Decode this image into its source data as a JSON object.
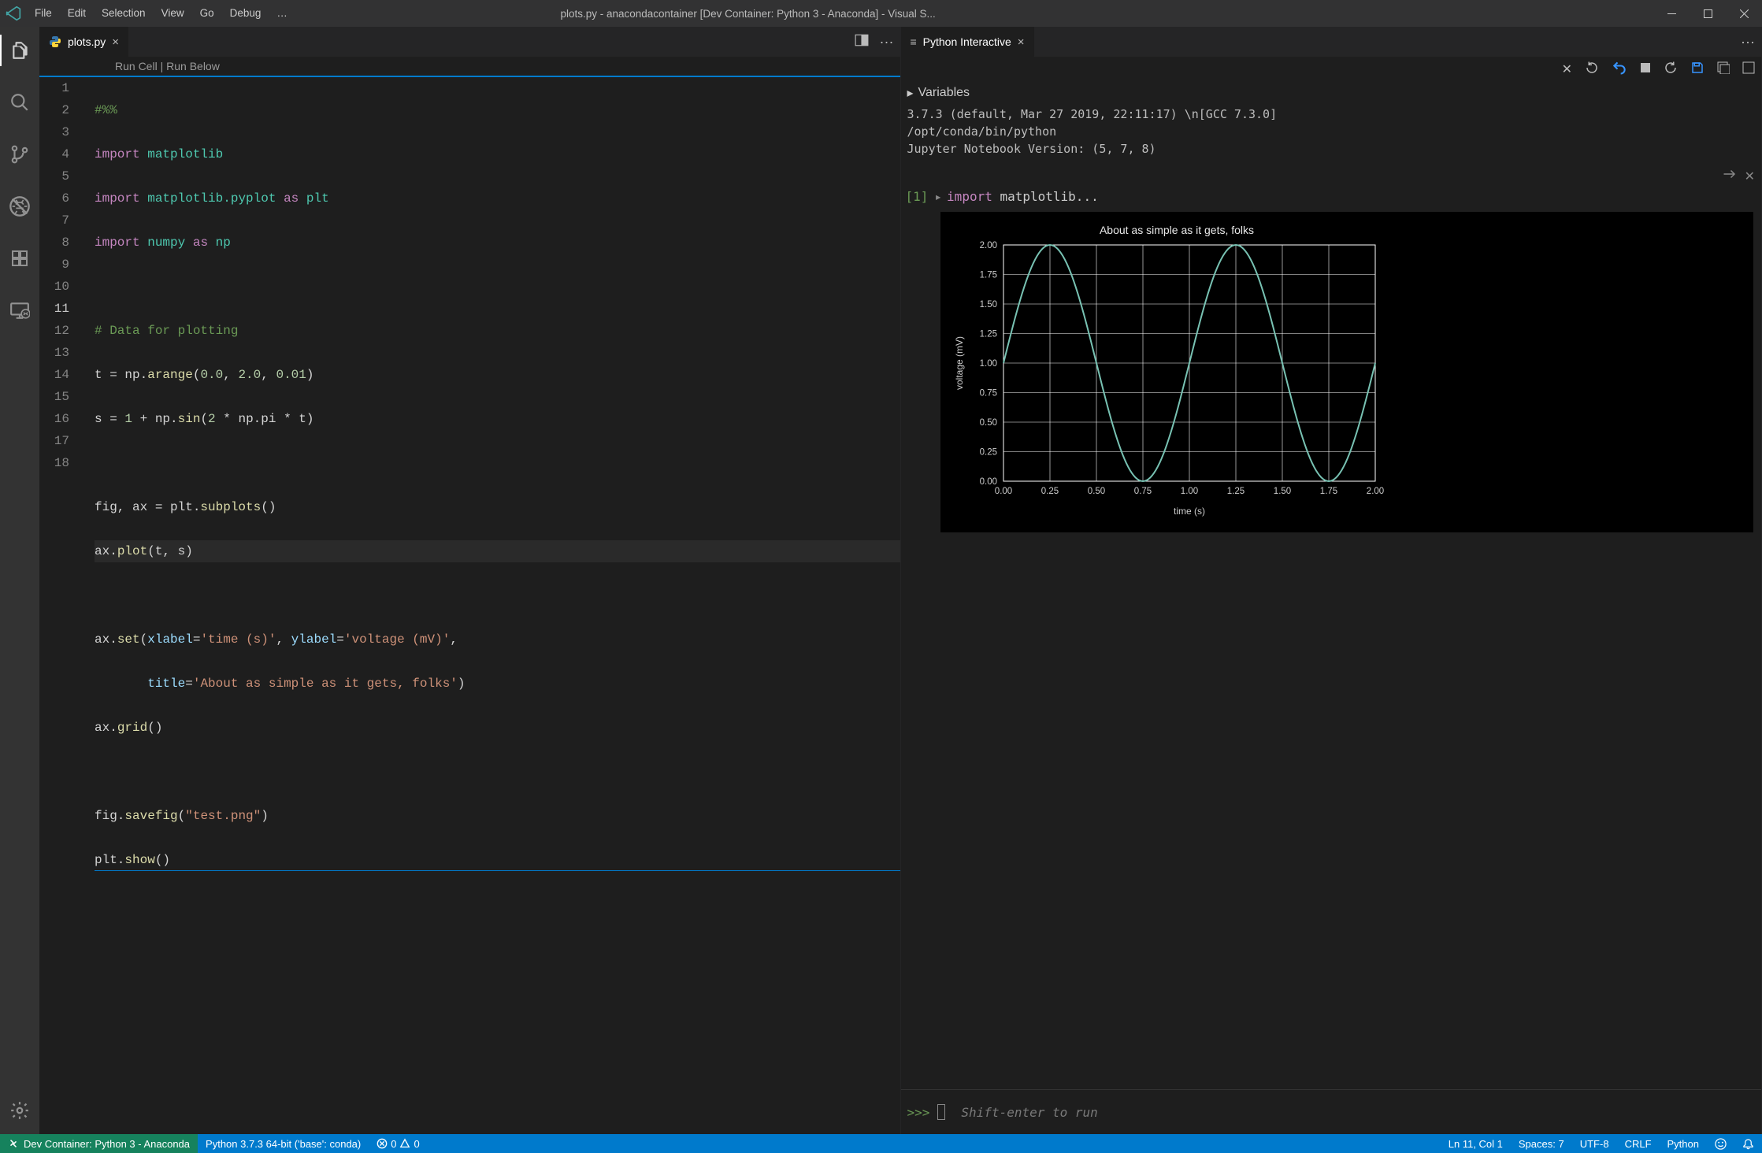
{
  "title": "plots.py - anacondacontainer [Dev Container: Python 3 - Anaconda] - Visual S...",
  "menu": {
    "file": "File",
    "edit": "Edit",
    "selection": "Selection",
    "view": "View",
    "go": "Go",
    "debug": "Debug",
    "more": "…"
  },
  "left_tab": {
    "filename": "plots.py"
  },
  "codelens": {
    "run_cell": "Run Cell",
    "run_below": "Run Below"
  },
  "right_tab": {
    "title": "Python Interactive"
  },
  "variables_header": "Variables",
  "info_lines": {
    "l1": "3.7.3 (default, Mar 27 2019, 22:11:17) \\n[GCC 7.3.0]",
    "l2": "/opt/conda/bin/python",
    "l3": "Jupyter Notebook Version: (5, 7, 8)"
  },
  "cell1": {
    "prompt": "[1]",
    "label_import": "import",
    "label_rest": " matplotlib..."
  },
  "repl": {
    "prompt": ">>>",
    "placeholder": "Shift-enter to run"
  },
  "status": {
    "remote": "Dev Container: Python 3 - Anaconda",
    "python": "Python 3.7.3 64-bit ('base': conda)",
    "errors": "0",
    "warnings": "0",
    "line": "Ln 11, Col 1",
    "spaces": "Spaces: 7",
    "encoding": "UTF-8",
    "eol": "CRLF",
    "lang": "Python"
  },
  "code": {
    "l1": "#%%",
    "kw_import": "import",
    "kw_as": "as",
    "mod_mpl": "matplotlib",
    "mod_pyplot": "matplotlib.pyplot",
    "alias_plt": "plt",
    "mod_numpy": "numpy",
    "alias_np": "np",
    "cmt_data": "# Data for plotting",
    "l7": "t = np.arange(0.0, 2.0, 0.01)",
    "l8": "s = 1 + np.sin(2 * np.pi * t)",
    "l10": "fig, ax = plt.subplots()",
    "l11": "ax.plot(t, s)",
    "l13": "ax.set(xlabel='time (s)', ylabel='voltage (mV)',",
    "l14": "       title='About as simple as it gets, folks')",
    "l15": "ax.grid()",
    "l17": "fig.savefig(\"test.png\")",
    "l18": "plt.show()"
  },
  "chart_data": {
    "type": "line",
    "title": "About as simple as it gets, folks",
    "xlabel": "time (s)",
    "ylabel": "voltage (mV)",
    "xlim": [
      0.0,
      2.0
    ],
    "ylim": [
      0.0,
      2.0
    ],
    "xticks": [
      0.0,
      0.25,
      0.5,
      0.75,
      1.0,
      1.25,
      1.5,
      1.75,
      2.0
    ],
    "yticks": [
      0.0,
      0.25,
      0.5,
      0.75,
      1.0,
      1.25,
      1.5,
      1.75,
      2.0
    ],
    "grid": true,
    "series": [
      {
        "name": "s",
        "formula": "1 + sin(2*pi*t)",
        "x_step": 0.01,
        "values": [
          [
            0.0,
            1.0
          ],
          [
            0.25,
            2.0
          ],
          [
            0.5,
            1.0
          ],
          [
            0.75,
            0.0
          ],
          [
            1.0,
            1.0
          ],
          [
            1.25,
            2.0
          ],
          [
            1.5,
            1.0
          ],
          [
            1.75,
            0.0
          ],
          [
            2.0,
            1.0
          ]
        ]
      }
    ]
  }
}
